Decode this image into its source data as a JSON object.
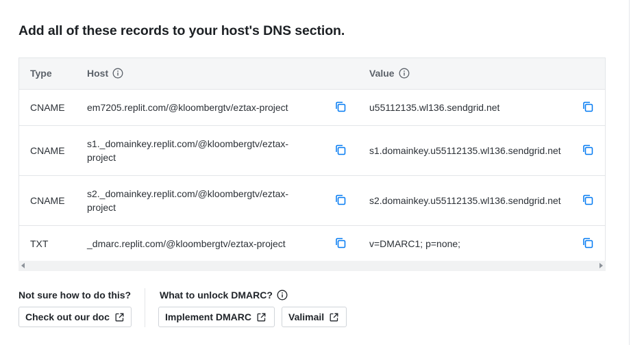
{
  "heading": "Add all of these records to your host's DNS section.",
  "table": {
    "headers": {
      "type": "Type",
      "host": "Host",
      "value": "Value"
    },
    "rows": [
      {
        "type": "CNAME",
        "host": "em7205.replit.com/@kloombergtv/eztax-project",
        "value": "u55112135.wl136.sendgrid.net"
      },
      {
        "type": "CNAME",
        "host": "s1._domainkey.replit.com/@kloombergtv/eztax-project",
        "value": "s1.domainkey.u55112135.wl136.sendgrid.net"
      },
      {
        "type": "CNAME",
        "host": "s2._domainkey.replit.com/@kloombergtv/eztax-project",
        "value": "s2.domainkey.u55112135.wl136.sendgrid.net"
      },
      {
        "type": "TXT",
        "host": "_dmarc.replit.com/@kloombergtv/eztax-project",
        "value": "v=DMARC1; p=none;"
      }
    ]
  },
  "help": {
    "doc_question": "Not sure how to do this?",
    "doc_button": "Check out our doc",
    "dmarc_question": "What to unlock DMARC?",
    "implement_button": "Implement DMARC",
    "valimail_button": "Valimail"
  },
  "icons": {
    "info": "info-circle-icon",
    "copy": "copy-icon",
    "external": "external-link-icon"
  },
  "colors": {
    "accent": "#0079f2",
    "header_bg": "#f5f6f7",
    "border": "#e3e5e8"
  }
}
